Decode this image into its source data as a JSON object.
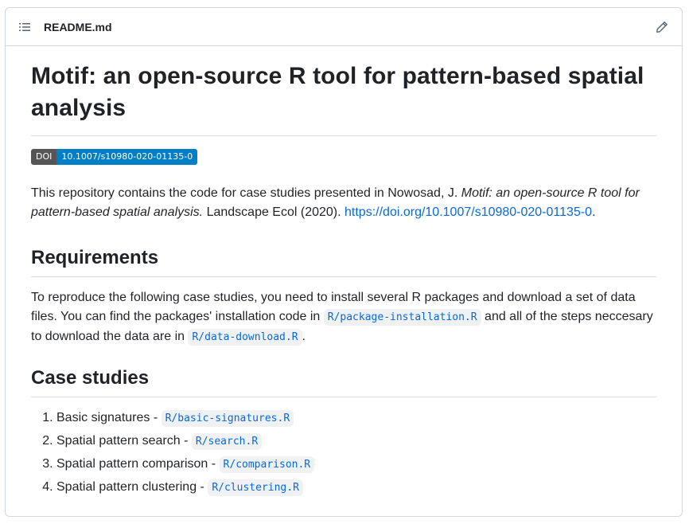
{
  "header": {
    "file_name": "README.md",
    "list_icon": "list-unordered-icon",
    "edit_icon": "pencil-icon"
  },
  "title": "Motif: an open-source R tool for pattern-based spatial analysis",
  "badge": {
    "label": "DOI",
    "value": "10.1007/s10980-020-01135-0",
    "label_color": "#555555",
    "value_color": "#007ec6"
  },
  "intro": {
    "text_before": "This repository contains the code for case studies presented in Nowosad, J. ",
    "italic": "Motif: an open-source R tool for pattern-based spatial analysis.",
    "text_after": " Landscape Ecol (2020). ",
    "link": "https://doi.org/10.1007/s10980-020-01135-0",
    "end": "."
  },
  "requirements": {
    "heading": "Requirements",
    "text1": "To reproduce the following case studies, you need to install several R packages and download a set of data files. You can find the packages' installation code in ",
    "code1": "R/package-installation.R",
    "text2": " and all of the steps neccesary to download the data are in ",
    "code2": "R/data-download.R",
    "text3": "."
  },
  "case_studies": {
    "heading": "Case studies",
    "items": [
      {
        "label": "Basic signatures - ",
        "file": "R/basic-signatures.R"
      },
      {
        "label": "Spatial pattern search - ",
        "file": "R/search.R"
      },
      {
        "label": "Spatial pattern comparison - ",
        "file": "R/comparison.R"
      },
      {
        "label": "Spatial pattern clustering - ",
        "file": "R/clustering.R"
      }
    ]
  },
  "colors": {
    "link": "#0969da",
    "border": "#d0d7de",
    "text": "#1f2328"
  }
}
